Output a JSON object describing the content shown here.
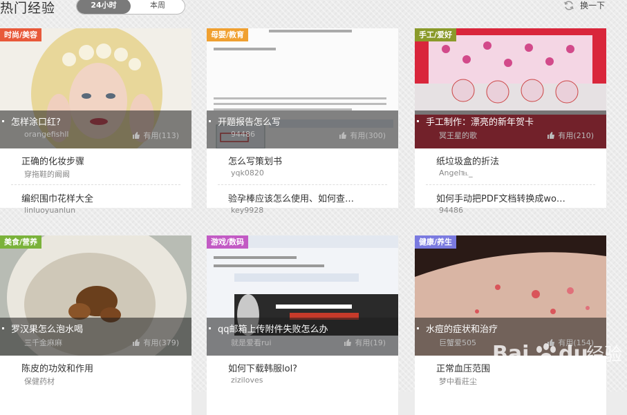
{
  "header": {
    "title": "热门经验",
    "tabs": [
      {
        "label": "24小时"
      },
      {
        "label": "本周"
      }
    ],
    "refresh_label": "换一下"
  },
  "cards": [
    {
      "category": "时尚/美容",
      "category_color": "#e8593a",
      "feature": {
        "title": "怎样涂口红?",
        "author": "orangefishll",
        "useful": "有用(113)"
      },
      "items": [
        {
          "title": "正确的化妆步骤",
          "author": "穿拖鞋的阚阚"
        },
        {
          "title": "编织围巾花样大全",
          "author": "linluoyuanlun"
        }
      ]
    },
    {
      "category": "母婴/教育",
      "category_color": "#f0a030",
      "feature": {
        "title": "开题报告怎么写",
        "author": "94486",
        "useful": "有用(300)"
      },
      "items": [
        {
          "title": "怎么写策划书",
          "author": "yqk0820"
        },
        {
          "title": "验孕棒应该怎么使用、如何查…",
          "author": "key9928"
        }
      ]
    },
    {
      "category": "手工/爱好",
      "category_color": "#8a9a2a",
      "feature": {
        "title": "手工制作：漂亮的新年贺卡",
        "author": "冥王星的歌",
        "useful": "有用(210)"
      },
      "items": [
        {
          "title": "纸垃圾盒的折法",
          "author": "Angel℡_"
        },
        {
          "title": "如何手动把PDF文档转换成wo…",
          "author": "94486"
        }
      ]
    },
    {
      "category": "美食/营养",
      "category_color": "#7ab23a",
      "feature": {
        "title": "罗汉果怎么泡水喝",
        "author": "三千金麻麻",
        "useful": "有用(379)"
      },
      "items": [
        {
          "title": "陈皮的功效和作用",
          "author": "保健药材"
        }
      ]
    },
    {
      "category": "游戏/数码",
      "category_color": "#c25ac4",
      "feature": {
        "title": "qq邮箱上传附件失败怎么办",
        "author": "就是爱看rui",
        "useful": "有用(19)"
      },
      "items": [
        {
          "title": "如何下载韩服lol?",
          "author": "ziziloves"
        }
      ]
    },
    {
      "category": "健康/养生",
      "category_color": "#7a7ae0",
      "feature": {
        "title": "水痘的症状和治疗",
        "author": "巨蟹爱505",
        "useful": "有用(154)"
      },
      "items": [
        {
          "title": "正常血压范围",
          "author": "梦中看莊尘"
        }
      ]
    }
  ],
  "watermark": {
    "brand": "Bai",
    "brand2": "du",
    "suffix": "经验",
    "url": "jingyan.baidu.com"
  }
}
